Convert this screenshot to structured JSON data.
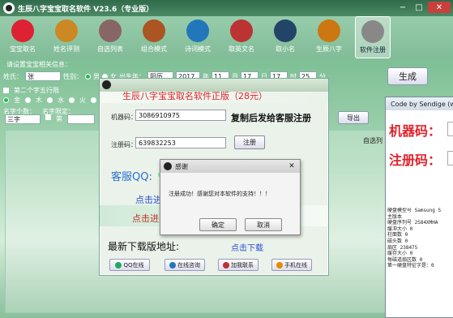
{
  "app": {
    "title": "生辰八字宝宝取名软件 V23.6（专业版）",
    "window_controls": [
      "min",
      "max",
      "close"
    ]
  },
  "toolbar": [
    {
      "label": "宝宝取名",
      "icon": "baby-icon",
      "color": "#d23"
    },
    {
      "label": "姓名评测",
      "icon": "rating-icon",
      "color": "#c82"
    },
    {
      "label": "自选列表",
      "icon": "list-icon",
      "color": "#866"
    },
    {
      "label": "组合模式",
      "icon": "combo-icon",
      "color": "#a52"
    },
    {
      "label": "诗词模式",
      "icon": "poem-icon",
      "color": "#27b"
    },
    {
      "label": "取英文名",
      "icon": "english-icon",
      "color": "#b33"
    },
    {
      "label": "取小名",
      "icon": "nickname-icon",
      "color": "#246"
    },
    {
      "label": "生辰八字",
      "icon": "bazi-icon",
      "color": "#c71"
    },
    {
      "label": "软件注册",
      "icon": "lock-icon",
      "color": "#888"
    }
  ],
  "form": {
    "section_title": "请设置宝宝相关信息：",
    "surname_label": "姓氏：",
    "surname_value": "张",
    "gender_label": "性别：",
    "gender_male": "男",
    "gender_female": "女",
    "birth_label": "出生年：",
    "calendar_value": "阳历",
    "year_value": "2017",
    "year_unit": "年",
    "month_value": "11",
    "month_unit": "月",
    "day_value": "17",
    "day_unit": "日",
    "hour_value": "17",
    "hour_unit": "时",
    "minute_value": "25",
    "minute_unit": "分",
    "second_char_label": "第二个字五行限",
    "wuxing": [
      "金",
      "木",
      "水",
      "火",
      "土"
    ],
    "name_len_label": "名字个数：",
    "name_len_value": "三字",
    "name_limit_label": "名字限定：",
    "first_label": "第",
    "second_label": "第",
    "generate_button": "生成",
    "export_button": "导出",
    "right_label": "自选列"
  },
  "promo": {
    "title": "生辰八字宝宝取名软件正版（28元）",
    "machine_label": "机器码：",
    "machine_value": "3086910975",
    "copy_tip": "复制后发给客服注册",
    "reg_label": "注册码：",
    "reg_value": "639832253",
    "reg_button": "注册",
    "qq_label": "客服QQ:",
    "link1": "点击进",
    "link2": "点击进",
    "download_label": "最新下载版地址:",
    "download_link": "点击下载",
    "buttons": [
      {
        "label": "QQ在线",
        "color": "#2a6"
      },
      {
        "label": "在线咨询",
        "color": "#27b"
      },
      {
        "label": "加我联系",
        "color": "#b33"
      },
      {
        "label": "手机在线",
        "color": "#e80"
      }
    ]
  },
  "dialog": {
    "title": "感谢",
    "message": "注册成功！感谢您对本软件的支持！！！",
    "ok_button": "确定",
    "cancel_button": "取消"
  },
  "rwin": {
    "title": "Code by Sendige (www.s",
    "machine_label": "机器码：",
    "reg_label": "注册码：",
    "info_lines": [
      "硬盘模型号   Samsung S",
      "主版本",
      "硬盘序列号   2S84XMHA",
      "缓冲大小     0",
      "柱面数       0",
      "磁头数       0",
      "扇区         238475",
      "缓存大小     0",
      "每磁道扇区数 0",
      "第一硬盘特征字是：0"
    ]
  }
}
